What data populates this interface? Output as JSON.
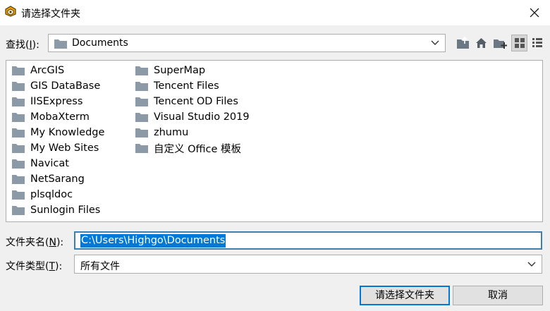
{
  "dialog": {
    "title": "请选择文件夹"
  },
  "lookin": {
    "label_prefix": "查找(",
    "label_key": "I",
    "label_suffix": "):",
    "value": "Documents"
  },
  "toolbar": {
    "buttons": [
      "up-one-level",
      "home",
      "new-folder",
      "list-view",
      "detail-view"
    ]
  },
  "files": {
    "column1": [
      "ArcGIS",
      "GIS DataBase",
      "IISExpress",
      "MobaXterm",
      "My Knowledge",
      "My Web Sites",
      "Navicat",
      "NetSarang",
      "plsqldoc",
      "Sunlogin Files"
    ],
    "column2": [
      "SuperMap",
      "Tencent Files",
      "Tencent OD Files",
      "Visual Studio 2019",
      "zhumu",
      "自定义 Office 模板"
    ]
  },
  "filename": {
    "label_prefix": "文件夹名(",
    "label_key": "N",
    "label_suffix": "):",
    "value": "C:\\Users\\Highgo\\Documents"
  },
  "filetype": {
    "label_prefix": "文件类型(",
    "label_key": "T",
    "label_suffix": "):",
    "value": "所有文件"
  },
  "buttons": {
    "ok": "请选择文件夹",
    "cancel": "取消"
  },
  "colors": {
    "selection": "#0078d7",
    "folder": "#8c9aa8",
    "focus_border": "#3c7fb1"
  }
}
